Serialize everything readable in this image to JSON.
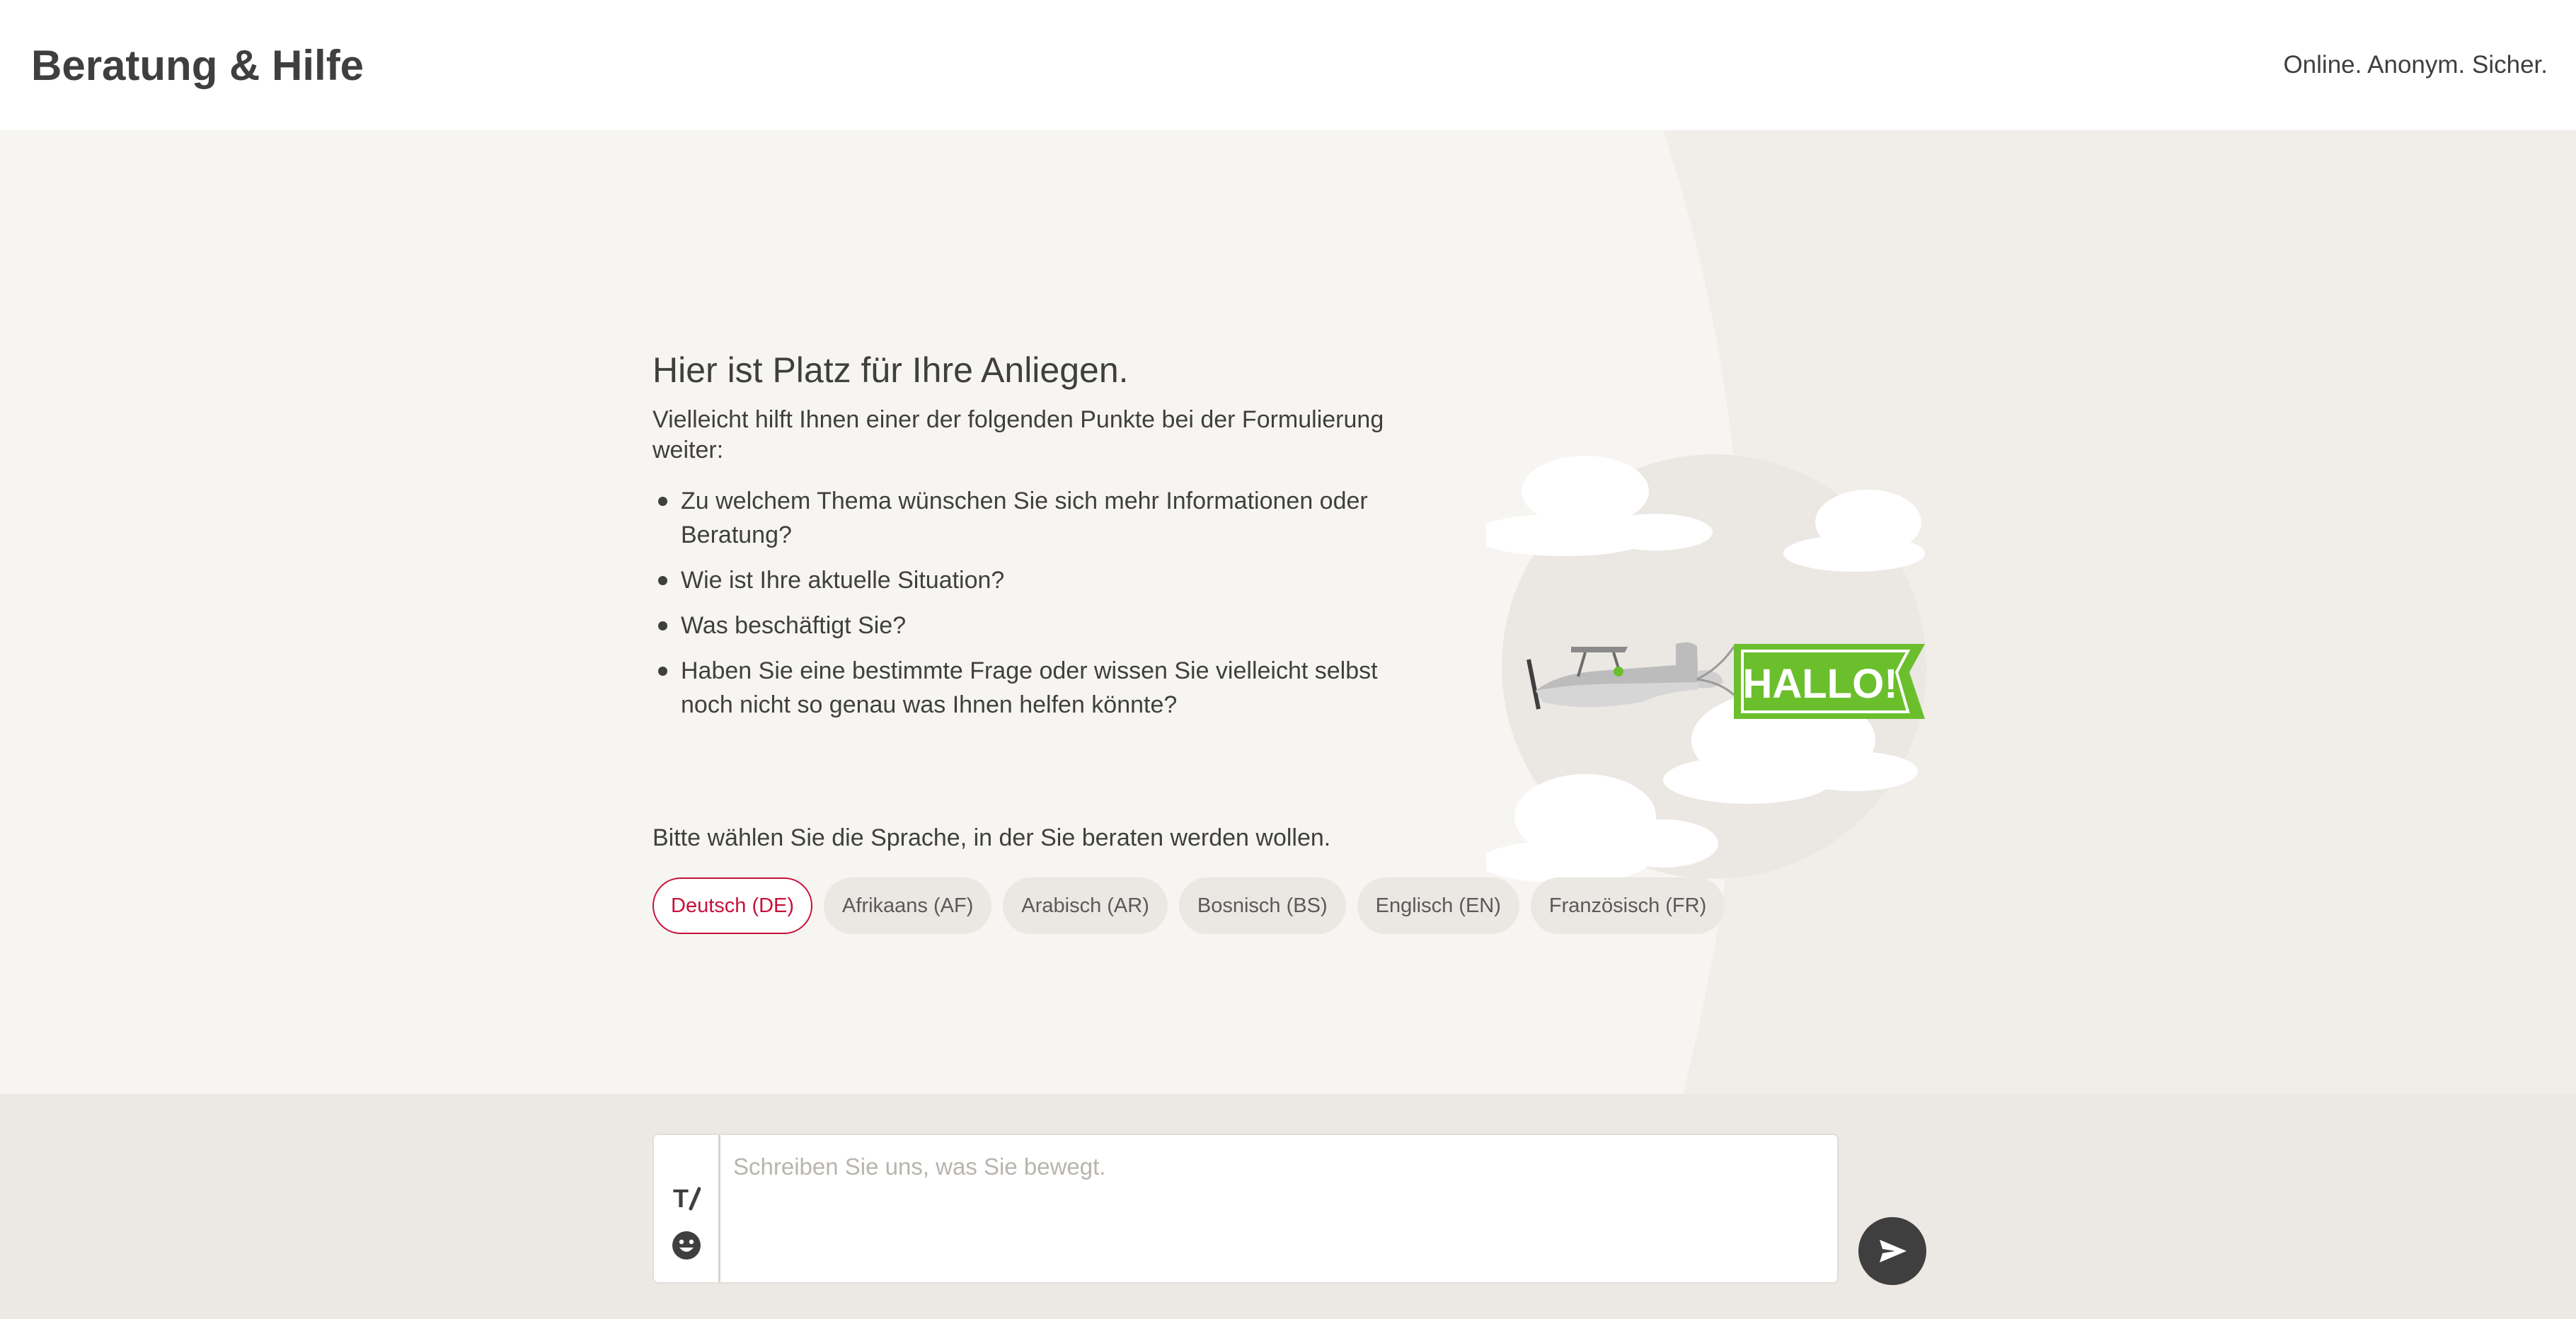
{
  "header": {
    "brand": "Beratung & Hilfe",
    "claim": "Online. Anonym. Sicher."
  },
  "intro": {
    "headline": "Hier ist Platz für Ihre Anliegen.",
    "text": "Vielleicht hilft Ihnen einer der folgenden Punkte bei der Formulierung weiter:",
    "points": [
      "Zu welchem Thema wünschen Sie sich mehr Informationen oder Beratung?",
      "Wie ist Ihre aktuelle Situation?",
      "Was beschäftigt Sie?",
      "Haben Sie eine bestimmte Frage oder wissen Sie vielleicht selbst noch nicht so genau was Ihnen helfen könnte?"
    ]
  },
  "illustration": {
    "banner_text": "HALLO!",
    "icon": "airplane-banner-illustration"
  },
  "language": {
    "label": "Bitte wählen Sie die Sprache, in der Sie beraten werden wollen.",
    "selected": "Deutsch (DE)",
    "options": [
      "Deutsch (DE)",
      "Afrikaans (AF)",
      "Arabisch (AR)",
      "Bosnisch (BS)",
      "Englisch (EN)",
      "Französisch (FR)"
    ]
  },
  "composer": {
    "placeholder": "Schreiben Sie uns, was Sie bewegt.",
    "format_icon": "text-format-icon",
    "emoji_icon": "emoji-icon",
    "send_icon": "send-icon"
  },
  "colors": {
    "accent": "#c7113a",
    "banner_green": "#6bbf2c",
    "dark": "#3f3f3f",
    "background": "#f7f5f2"
  }
}
